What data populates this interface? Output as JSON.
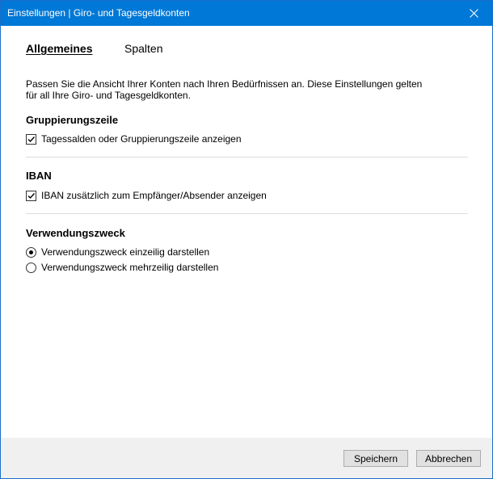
{
  "window": {
    "title": "Einstellungen | Giro- und Tagesgeldkonten",
    "accent_color": "#0078d7",
    "close_icon": "close-icon"
  },
  "tabs": [
    {
      "label": "Allgemeines",
      "active": true
    },
    {
      "label": "Spalten",
      "active": false
    }
  ],
  "description": {
    "line1": "Passen Sie die Ansicht Ihrer Konten nach Ihren Bedürfnissen an. Diese Einstellungen gelten",
    "line2": "für all Ihre Giro- und Tagesgeldkonten."
  },
  "sections": {
    "grouping": {
      "title": "Gruppierungszeile",
      "option_label": "Tagessalden oder Gruppierungszeile anzeigen",
      "checked": true
    },
    "iban": {
      "title": "IBAN",
      "option_label": "IBAN zusätzlich zum Empfänger/Absender anzeigen",
      "checked": true
    },
    "purpose": {
      "title": "Verwendungszweck",
      "options": [
        {
          "label": "Verwendungszweck einzeilig darstellen",
          "selected": true
        },
        {
          "label": "Verwendungszweck mehrzeilig darstellen",
          "selected": false
        }
      ]
    }
  },
  "footer": {
    "save_label": "Speichern",
    "cancel_label": "Abbrechen"
  }
}
